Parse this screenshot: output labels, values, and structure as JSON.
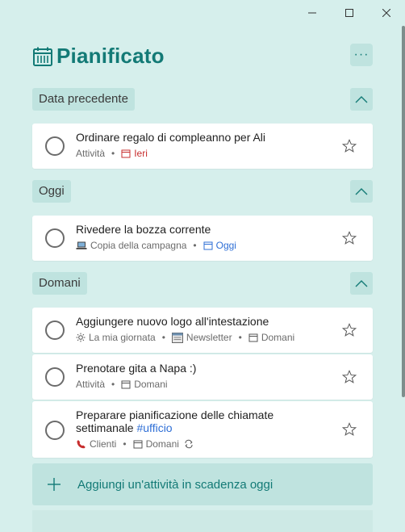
{
  "window": {
    "minimize": "minimize",
    "maximize": "maximize",
    "close": "close"
  },
  "header": {
    "title": "Pianificato",
    "more": "···"
  },
  "sections": [
    {
      "label": "Data precedente"
    },
    {
      "label": "Oggi"
    },
    {
      "label": "Domani"
    }
  ],
  "tasks": [
    {
      "title": "Ordinare regalo di compleanno per Ali",
      "list": "Attività",
      "due": "Ieri"
    },
    {
      "title": "Rivedere la bozza corrente",
      "list": "Copia della campagna",
      "due": "Oggi"
    },
    {
      "title": "Aggiungere nuovo logo all'intestazione",
      "myday": "La mia giornata",
      "list": "Newsletter",
      "due": "Domani"
    },
    {
      "title": "Prenotare gita a Napa :)",
      "list": "Attività",
      "due": "Domani"
    },
    {
      "title": "Preparare pianificazione delle chiamate settimanale",
      "tag": "#ufficio",
      "list": "Clienti",
      "due": "Domani"
    }
  ],
  "add_task": {
    "label": "Aggiungi un'attività in scadenza oggi"
  },
  "colors": {
    "accent": "#137a76",
    "background": "#d6efec",
    "overdue": "#c72e2e",
    "today": "#2f6fd6"
  },
  "icons": [
    "calendar-icon",
    "more-icon",
    "chevron-up-icon",
    "star-icon",
    "sun-icon",
    "laptop-icon",
    "newsletter-icon",
    "phone-icon",
    "repeat-icon",
    "plus-icon"
  ]
}
